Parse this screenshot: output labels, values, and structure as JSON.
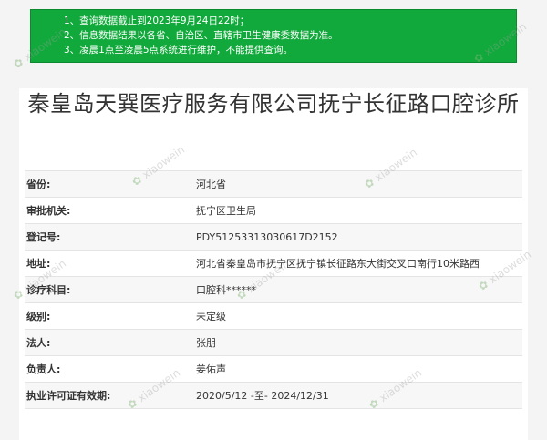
{
  "notice": {
    "lines": [
      "1、查询数据截止到2023年9月24日22时；",
      "2、信息数据结果以各省、自治区、直辖市卫生健康委数据为准。",
      "3、凌晨1点至凌晨5点系统进行维护，不能提供查询。"
    ]
  },
  "title": "秦皇岛天巽医疗服务有限公司抚宁长征路口腔诊所",
  "rows": [
    {
      "label": "省份:",
      "value": "河北省"
    },
    {
      "label": "审批机关:",
      "value": "抚宁区卫生局"
    },
    {
      "label": "登记号:",
      "value": "PDY51253313030617D2152"
    },
    {
      "label": "地址:",
      "value": "河北省秦皇岛市抚宁区抚宁镇长征路东大街交叉口南行10米路西"
    },
    {
      "label": "诊疗科目:",
      "value": "口腔科******"
    },
    {
      "label": "级别:",
      "value": "未定级"
    },
    {
      "label": "法人:",
      "value": "张朋"
    },
    {
      "label": "负责人:",
      "value": "姜佑声"
    },
    {
      "label": "执业许可证有效期:",
      "value": "2020/5/12 -至- 2024/12/31"
    }
  ],
  "watermark": {
    "text": "xiaowein",
    "icon": "leaf-logo-icon"
  }
}
